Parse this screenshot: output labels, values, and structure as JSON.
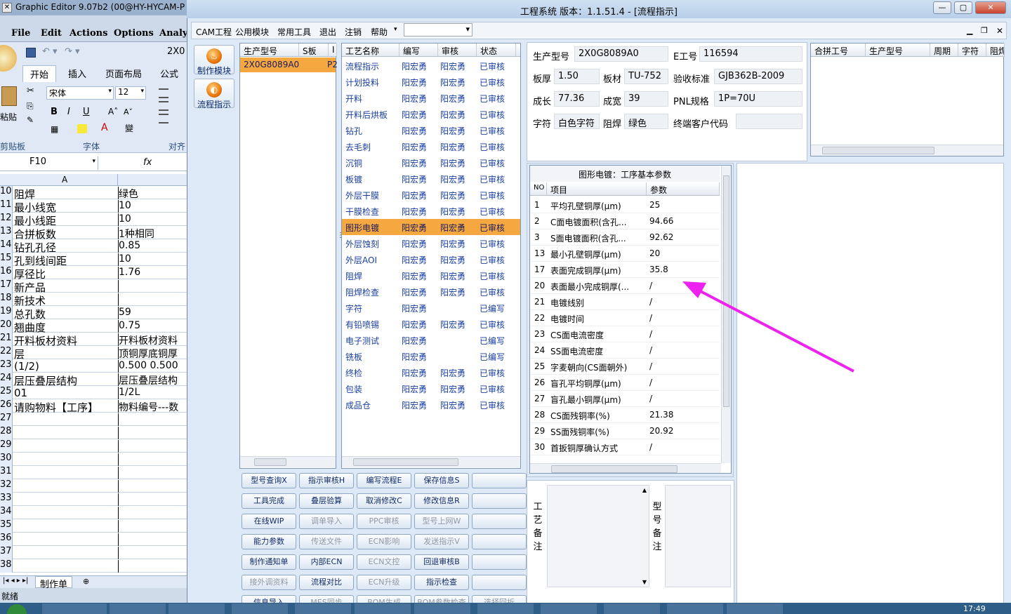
{
  "background_app": {
    "title": "Graphic Editor 9.07b2 (00@HY-HYCAM-P",
    "menu": [
      "File",
      "Edit",
      "Actions",
      "Options",
      "Analy"
    ],
    "ribbon_tabs": [
      "开始",
      "插入",
      "页面布局",
      "公式"
    ],
    "title_cell": "2X0",
    "paste_label": "粘贴",
    "font_name": "宋体",
    "font_size": "12",
    "group_clipboard": "剪贴板",
    "group_font": "字体",
    "group_align": "对齐",
    "name_box": "F10",
    "fx": "fx",
    "col_a": "A",
    "rows": [
      {
        "n": "10",
        "a": "阻焊",
        "b": "绿色"
      },
      {
        "n": "11",
        "a": "最小线宽",
        "b": "10"
      },
      {
        "n": "12",
        "a": "最小线距",
        "b": "10"
      },
      {
        "n": "13",
        "a": "合拼板数",
        "b": "1种相同"
      },
      {
        "n": "14",
        "a": "钻孔孔径",
        "b": "0.85"
      },
      {
        "n": "15",
        "a": "孔到线间距",
        "b": "10"
      },
      {
        "n": "16",
        "a": "厚径比",
        "b": "1.76"
      },
      {
        "n": "17",
        "a": "新产品",
        "b": ""
      },
      {
        "n": "18",
        "a": "新技术",
        "b": ""
      },
      {
        "n": "19",
        "a": "总孔数",
        "b": "59"
      },
      {
        "n": "20",
        "a": "翘曲度",
        "b": "0.75"
      },
      {
        "n": "21",
        "a": "开料板材资料",
        "b": "开料板材资料"
      },
      {
        "n": "22",
        "a": "层",
        "b": "顶铜厚底铜厚"
      },
      {
        "n": "23",
        "a": "(1/2)",
        "b": "0.500  0.500"
      },
      {
        "n": "24",
        "a": "层压叠层结构",
        "b": "层压叠层结构"
      },
      {
        "n": "25",
        "a": "01",
        "b": "1/2L"
      },
      {
        "n": "26",
        "a": "请购物料【工序】",
        "b": "物料编号---数"
      },
      {
        "n": "27",
        "a": "",
        "b": ""
      },
      {
        "n": "28",
        "a": "",
        "b": ""
      },
      {
        "n": "29",
        "a": "",
        "b": ""
      },
      {
        "n": "30",
        "a": "",
        "b": ""
      },
      {
        "n": "31",
        "a": "",
        "b": ""
      },
      {
        "n": "32",
        "a": "",
        "b": ""
      },
      {
        "n": "33",
        "a": "",
        "b": ""
      },
      {
        "n": "34",
        "a": "",
        "b": ""
      },
      {
        "n": "35",
        "a": "",
        "b": ""
      },
      {
        "n": "36",
        "a": "",
        "b": ""
      },
      {
        "n": "37",
        "a": "",
        "b": ""
      },
      {
        "n": "38",
        "a": "",
        "b": ""
      }
    ],
    "sheet_tab": "制作单",
    "status": "就绪"
  },
  "window": {
    "title": "工程系统  版本：1.1.51.4 - [流程指示]",
    "menu": [
      "CAM工程",
      "公用模块",
      "常用工具",
      "退出",
      "注销",
      "帮助"
    ],
    "side_buttons": [
      "制作模块",
      "流程指示"
    ]
  },
  "model_grid": {
    "headers": [
      "生产型号",
      "S板",
      "I"
    ],
    "rows": [
      {
        "model": "2X0G8089A0",
        "s": "P2"
      }
    ]
  },
  "process_grid": {
    "headers": [
      "工艺名称",
      "编写",
      "审核",
      "状态"
    ],
    "selected_index": 10,
    "rows": [
      {
        "name": "流程指示",
        "writer": "阳宏勇",
        "reviewer": "阳宏勇",
        "status": "已审核"
      },
      {
        "name": "计划投料",
        "writer": "阳宏勇",
        "reviewer": "阳宏勇",
        "status": "已审核"
      },
      {
        "name": "开料",
        "writer": "阳宏勇",
        "reviewer": "阳宏勇",
        "status": "已审核"
      },
      {
        "name": "开料后烘板",
        "writer": "阳宏勇",
        "reviewer": "阳宏勇",
        "status": "已审核"
      },
      {
        "name": "钻孔",
        "writer": "阳宏勇",
        "reviewer": "阳宏勇",
        "status": "已审核"
      },
      {
        "name": "去毛刺",
        "writer": "阳宏勇",
        "reviewer": "阳宏勇",
        "status": "已审核"
      },
      {
        "name": "沉铜",
        "writer": "阳宏勇",
        "reviewer": "阳宏勇",
        "status": "已审核"
      },
      {
        "name": "板镀",
        "writer": "阳宏勇",
        "reviewer": "阳宏勇",
        "status": "已审核"
      },
      {
        "name": "外层干膜",
        "writer": "阳宏勇",
        "reviewer": "阳宏勇",
        "status": "已审核"
      },
      {
        "name": "干膜检查",
        "writer": "阳宏勇",
        "reviewer": "阳宏勇",
        "status": "已审核"
      },
      {
        "name": "图形电镀",
        "writer": "阳宏勇",
        "reviewer": "阳宏勇",
        "status": "已审核"
      },
      {
        "name": "外层蚀刻",
        "writer": "阳宏勇",
        "reviewer": "阳宏勇",
        "status": "已审核"
      },
      {
        "name": "外层AOI",
        "writer": "阳宏勇",
        "reviewer": "阳宏勇",
        "status": "已审核"
      },
      {
        "name": "阻焊",
        "writer": "阳宏勇",
        "reviewer": "阳宏勇",
        "status": "已审核"
      },
      {
        "name": "阻焊检查",
        "writer": "阳宏勇",
        "reviewer": "阳宏勇",
        "status": "已审核"
      },
      {
        "name": "字符",
        "writer": "阳宏勇",
        "reviewer": "",
        "status": "已编写"
      },
      {
        "name": "有铅喷锡",
        "writer": "阳宏勇",
        "reviewer": "阳宏勇",
        "status": "已审核"
      },
      {
        "name": "电子测试",
        "writer": "阳宏勇",
        "reviewer": "",
        "status": "已编写"
      },
      {
        "name": "铣板",
        "writer": "阳宏勇",
        "reviewer": "",
        "status": "已编写"
      },
      {
        "name": "终检",
        "writer": "阳宏勇",
        "reviewer": "阳宏勇",
        "status": "已审核"
      },
      {
        "name": "包装",
        "writer": "阳宏勇",
        "reviewer": "阳宏勇",
        "status": "已审核"
      },
      {
        "name": "成品仓",
        "writer": "阳宏勇",
        "reviewer": "阳宏勇",
        "status": "已审核"
      }
    ]
  },
  "buttons": [
    [
      "型号查询X",
      "指示审核H",
      "编写流程E",
      "保存信息S",
      ""
    ],
    [
      "工具完成",
      "叠层验算",
      "取消修改C",
      "修改信息R",
      ""
    ],
    [
      "在线WIP",
      "调单导入",
      "PPC审核",
      "型号上网W",
      ""
    ],
    [
      "能力参数",
      "传送文件",
      "ECN影响",
      "发送指示V",
      ""
    ],
    [
      "制作通知单",
      "内部ECN",
      "ECN文控",
      "回退审核B",
      ""
    ],
    [
      "接外调资料",
      "流程对比",
      "ECN升级",
      "指示检查",
      ""
    ],
    [
      "信息导入",
      "MES同步",
      "BOM生成",
      "BOM参数检查",
      "选择回折"
    ]
  ],
  "disabled_buttons": [
    "调单导入",
    "PPC审核",
    "型号上网W",
    "传送文件",
    "ECN影响",
    "发送指示V",
    "ECN文控",
    "接外调资料",
    "ECN升级",
    "MES同步",
    "BOM生成",
    "BOM参数检查",
    "选择回折"
  ],
  "info": {
    "model_label": "生产型号",
    "model": "2X0G8089A0",
    "e_label": "E工号",
    "e": "116594",
    "thick_label": "板厚",
    "thick": "1.50",
    "material_label": "板材",
    "material": "TU-752",
    "std_label": "验收标准",
    "std": "GJB362B-2009",
    "len_label": "成长",
    "len": "77.36",
    "wid_label": "成宽",
    "wid": "39",
    "pnl_label": "PNL规格",
    "pnl": "1P=70U",
    "char_label": "字符",
    "char": "白色字符",
    "mask_label": "阻焊",
    "mask": "绿色",
    "client_label": "终端客户代码",
    "client": ""
  },
  "merge_grid": {
    "headers": [
      "合拼工号",
      "生产型号",
      "周期",
      "字符",
      "阻焊"
    ]
  },
  "params": {
    "title": "图形电镀：工序基本参数",
    "headers": [
      "NO",
      "项目",
      "参数"
    ],
    "rows": [
      {
        "no": "1",
        "item": "平均孔壁铜厚(μm)",
        "val": "25"
      },
      {
        "no": "2",
        "item": "C面电镀面积(含孔...",
        "val": "94.66"
      },
      {
        "no": "3",
        "item": "S面电镀面积(含孔...",
        "val": "92.62"
      },
      {
        "no": "13",
        "item": "最小孔壁铜厚(μm)",
        "val": "20"
      },
      {
        "no": "17",
        "item": "表面完成铜厚(μm)",
        "val": "35.8"
      },
      {
        "no": "20",
        "item": "表面最小完成铜厚(...",
        "val": "/"
      },
      {
        "no": "21",
        "item": "电镀线别",
        "val": "/"
      },
      {
        "no": "22",
        "item": "电镀时间",
        "val": "/"
      },
      {
        "no": "23",
        "item": "CS面电流密度",
        "val": "/"
      },
      {
        "no": "24",
        "item": "SS面电流密度",
        "val": "/"
      },
      {
        "no": "25",
        "item": "字麦朝向(CS面朝外)",
        "val": "/"
      },
      {
        "no": "26",
        "item": "盲孔平均铜厚(μm)",
        "val": "/"
      },
      {
        "no": "27",
        "item": "盲孔最小铜厚(μm)",
        "val": "/"
      },
      {
        "no": "28",
        "item": "CS面残铜率(%)",
        "val": "21.38"
      },
      {
        "no": "29",
        "item": "SS面残铜率(%)",
        "val": "20.92"
      },
      {
        "no": "30",
        "item": "首扳铜厚确认方式",
        "val": "/"
      }
    ]
  },
  "notes": {
    "process_label": [
      "工",
      "艺",
      "备",
      "注"
    ],
    "model_label": [
      "型",
      "号",
      "备",
      "注"
    ]
  },
  "clock": "17:49",
  "colors": {
    "accent": "#f6a840",
    "arrow": "#ee22ee",
    "link": "#1a3fa0"
  }
}
